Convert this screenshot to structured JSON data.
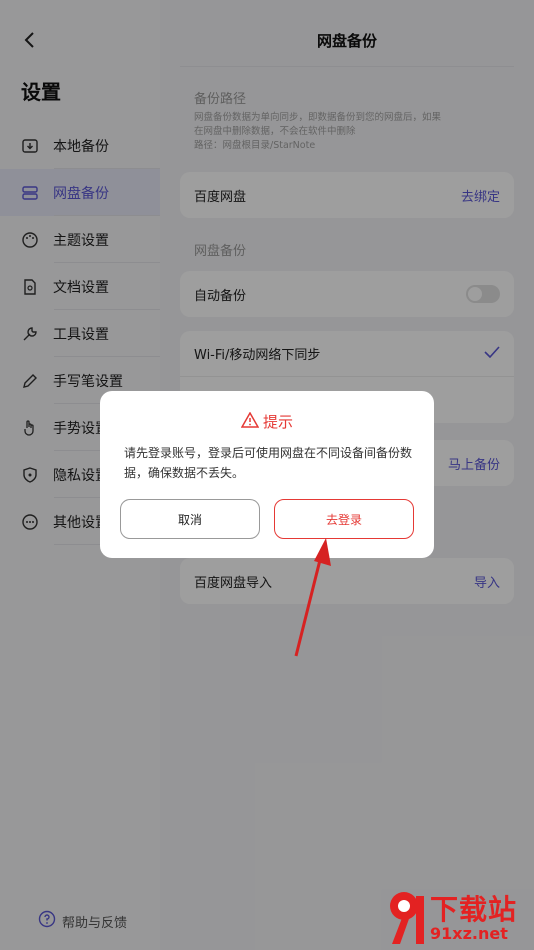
{
  "sidebar": {
    "title": "设置",
    "items": [
      {
        "label": "本地备份",
        "icon": "local-backup-icon"
      },
      {
        "label": "网盘备份",
        "icon": "cloud-backup-icon",
        "active": true
      },
      {
        "label": "主题设置",
        "icon": "palette-icon"
      },
      {
        "label": "文档设置",
        "icon": "document-settings-icon"
      },
      {
        "label": "工具设置",
        "icon": "wrench-icon"
      },
      {
        "label": "手写笔设置",
        "icon": "pen-icon"
      },
      {
        "label": "手势设置",
        "icon": "hand-gesture-icon"
      },
      {
        "label": "隐私设置",
        "icon": "shield-icon"
      },
      {
        "label": "其他设置",
        "icon": "more-icon"
      }
    ],
    "help_label": "帮助与反馈"
  },
  "main": {
    "title": "网盘备份",
    "backup_path": {
      "section_label": "备份路径",
      "note_line1": "网盘备份数据为单向同步，即数据备份到您的网盘后，如果",
      "note_line2": "在网盘中删除数据，不会在软件中删除",
      "note_line3": "路径：网盘根目录/StarNote"
    },
    "baidu_card": {
      "label": "百度网盘",
      "action": "去绑定"
    },
    "cloud_section_label": "网盘备份",
    "auto_backup": {
      "label": "自动备份",
      "enabled": false
    },
    "sync_option": {
      "label": "Wi-Fi/移动网络下同步",
      "checked": true
    },
    "backup_now_action": "马上备份",
    "import_card": {
      "label": "百度网盘导入",
      "action": "导入"
    }
  },
  "dialog": {
    "title": "提示",
    "message": "请先登录账号，登录后可使用网盘在不同设备间备份数据，确保数据不丢失。",
    "cancel_label": "取消",
    "confirm_label": "去登录"
  },
  "watermark": {
    "text_top": "下载站",
    "text_bottom": "91xz.net"
  },
  "colors": {
    "accent": "#5b57d6",
    "danger": "#e53935"
  }
}
